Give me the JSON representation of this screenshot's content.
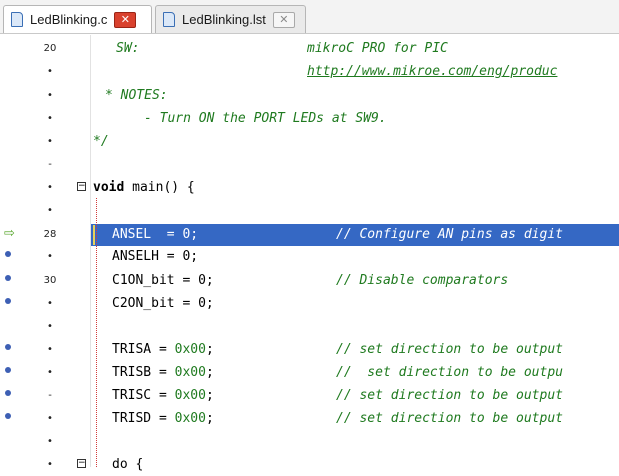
{
  "tabs": [
    {
      "label": "LedBlinking.c",
      "close": "✕"
    },
    {
      "label": "LedBlinking.lst",
      "close": "✕"
    }
  ],
  "gutter": {
    "line_20": "20",
    "line_28": "28",
    "line_30": "30",
    "dot": "•",
    "dash": "-"
  },
  "code": {
    "sw_label": "SW:",
    "sw_value": "mikroC PRO for PIC",
    "url": "http://www.mikroe.com/eng/produc",
    "notes": "* NOTES:",
    "note_1": "- Turn ON the PORT LEDs at SW9.",
    "comment_end": "*/",
    "main_kw": "void",
    "main_rest": " main() {",
    "ansel": "ANSEL  = 0;",
    "ansel_comment": "// Configure AN pins as digit",
    "anselh": "ANSELH = 0;",
    "c1on": "C1ON_bit = 0;",
    "c1on_comment": "// Disable comparators",
    "c2on": "C2ON_bit = 0;",
    "trisa": "TRISA = ",
    "trisb": "TRISB = ",
    "trisc": "TRISC = ",
    "trisd": "TRISD = ",
    "hex_zero": "0x00",
    "semi": ";",
    "trisa_comment": "// set direction to be output",
    "trisb_comment": "//  set direction to be outpu",
    "trisc_comment": "// set direction to be output",
    "trisd_comment": "// set direction to be output",
    "do_line": "do {"
  },
  "colors": {
    "highlight": "#3568c4",
    "comment": "#1f7a1f",
    "breakpoint": "#3d5fb4",
    "exec_arrow": "#5aa72f",
    "close_active": "#d9412e"
  },
  "icons": [
    "file-icon",
    "close-icon",
    "exec-arrow-icon",
    "breakpoint-dot-icon",
    "fold-toggle-icon"
  ]
}
